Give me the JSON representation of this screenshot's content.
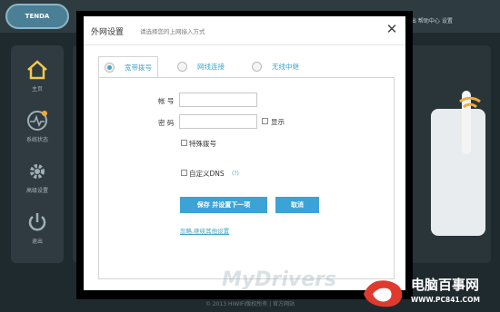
{
  "background": {
    "logo_text": "TENDA",
    "top_links": "退出  帮助中心  设置",
    "sidebar": [
      {
        "label": "主页",
        "icon": "home-icon"
      },
      {
        "label": "系统状态",
        "icon": "status-icon"
      },
      {
        "label": "高级设置",
        "icon": "gear-icon"
      },
      {
        "label": "退出",
        "icon": "power-icon"
      }
    ],
    "footer": "© 2013 HIWIFI版权所有 | 官方网站"
  },
  "dialog": {
    "title": "外网设置",
    "subtitle": "请选择您的上网接入方式",
    "close_symbol": "✕",
    "tabs": [
      {
        "label": "宽带拨号",
        "selected": true
      },
      {
        "label": "网线连接",
        "selected": false
      },
      {
        "label": "无线中继",
        "selected": false
      }
    ],
    "form": {
      "account_label": "帐 号",
      "account_value": "",
      "password_label": "密 码",
      "password_value": "",
      "show_label": "显示",
      "special_dial_label": "特殊拨号",
      "custom_dns_label": "自定义DNS",
      "help_mark": "(?)"
    },
    "buttons": {
      "save_next": "保存 并设置下一项",
      "cancel": "取消"
    },
    "skip_link": "忽略,继续其他设置"
  },
  "watermark": {
    "mydrivers": "MyDrivers",
    "brand_title": "电脑百事网",
    "brand_url": "WWW.PC841.COM"
  },
  "colors": {
    "accent": "#3ba3d6",
    "tab_text": "#3da5c8",
    "backdrop": "#1f2a2e"
  }
}
